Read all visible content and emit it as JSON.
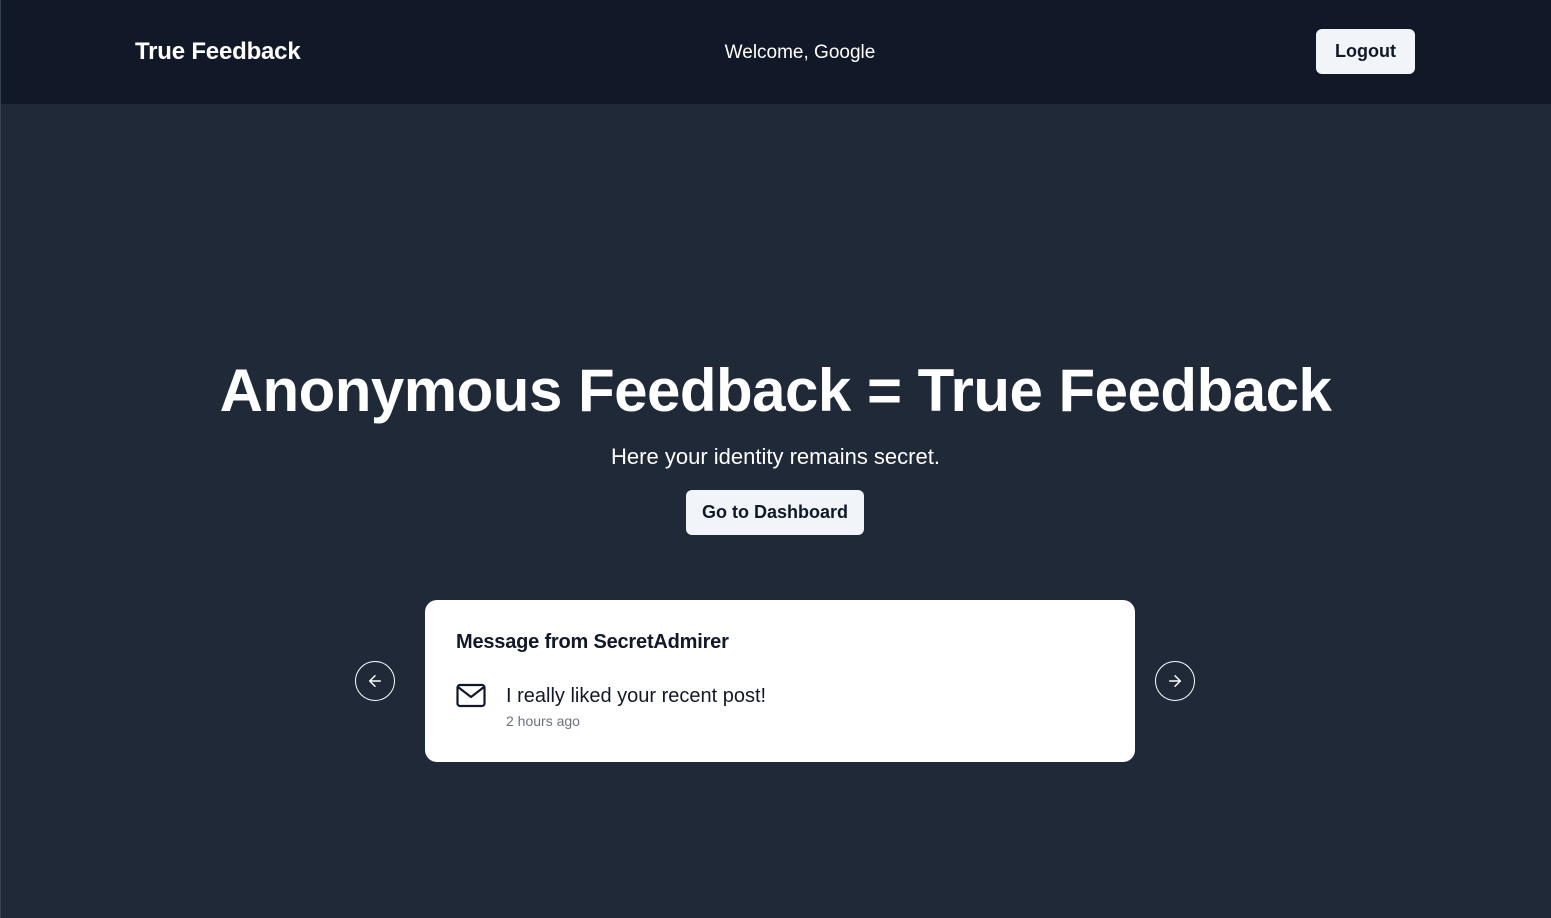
{
  "navbar": {
    "brand": "True Feedback",
    "welcome": "Welcome, Google",
    "logout_label": "Logout"
  },
  "hero": {
    "title": "Anonymous Feedback = True Feedback",
    "subtitle": "Here your identity remains secret.",
    "dashboard_label": "Go to Dashboard"
  },
  "carousel": {
    "prev_icon": "arrow-left-icon",
    "next_icon": "arrow-right-icon",
    "card": {
      "title": "Message from SecretAdmirer",
      "icon": "mail-icon",
      "message": "I really liked your recent post!",
      "time": "2 hours ago"
    }
  },
  "colors": {
    "navbar_bg": "#111827",
    "page_bg": "#1f2937",
    "button_bg": "#f1f5f9",
    "card_bg": "#ffffff"
  }
}
